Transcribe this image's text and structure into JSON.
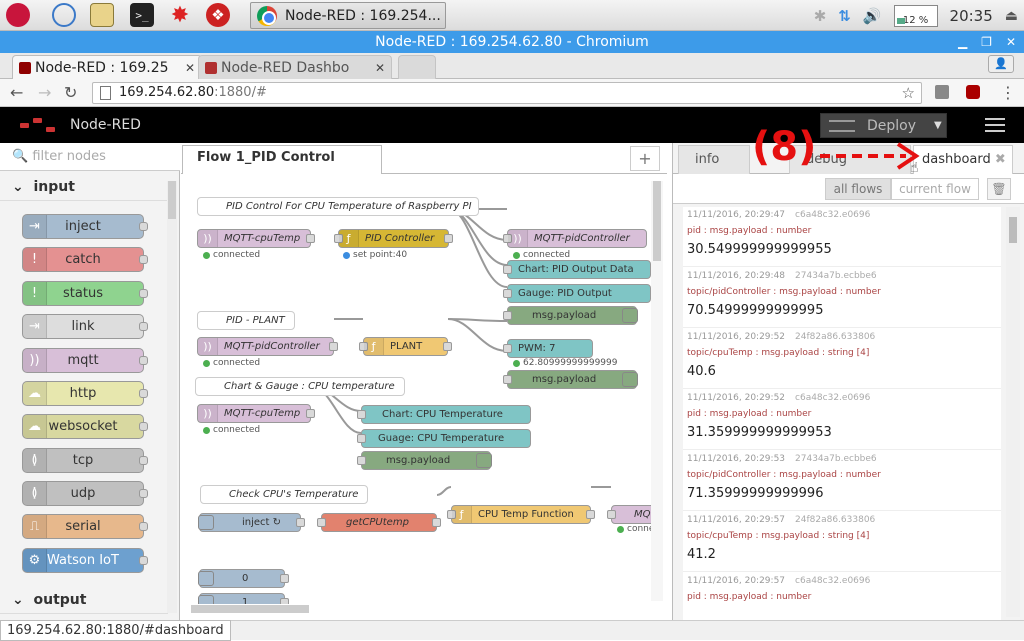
{
  "taskbar": {
    "task_title": "Node-RED : 169.254...",
    "cpu": "12 %",
    "clock": "20:35"
  },
  "window": {
    "title": "Node-RED : 169.254.62.80 - Chromium"
  },
  "browser": {
    "tabs": [
      {
        "label": "Node-RED : 169.25"
      },
      {
        "label": "Node-RED Dashbo"
      }
    ],
    "url_host": "169.254.62.80",
    "url_rest": ":1880/#"
  },
  "nodered": {
    "app_title": "Node-RED",
    "deploy_label": "Deploy"
  },
  "palette": {
    "filter_placeholder": "filter nodes",
    "categories": [
      {
        "label": "input"
      },
      {
        "label": "output"
      }
    ],
    "nodes": [
      {
        "label": "inject",
        "color": "#a6bbcf"
      },
      {
        "label": "catch",
        "color": "#e49191"
      },
      {
        "label": "status",
        "color": "#94c1d0"
      },
      {
        "label": "link",
        "color": "#dddddd"
      },
      {
        "label": "mqtt",
        "color": "#d8bfd8"
      },
      {
        "label": "http",
        "color": "#e7e7ae"
      },
      {
        "label": "websocket",
        "color": "#d8d8a0"
      },
      {
        "label": "tcp",
        "color": "#c0c0c0"
      },
      {
        "label": "udp",
        "color": "#c0c0c0"
      },
      {
        "label": "serial",
        "color": "#e7b88c"
      },
      {
        "label": "Watson IoT",
        "color": "#6da0cf"
      }
    ]
  },
  "workspace": {
    "flow_tab": "Flow 1_PID Control",
    "comments": [
      {
        "label": "PID Control For CPU Temperature of Raspberry PI"
      },
      {
        "label": "PID - PLANT"
      },
      {
        "label": "Chart & Gauge : CPU temperature"
      },
      {
        "label": "Check CPU's Temperature"
      }
    ],
    "nodes": [
      {
        "label": "MQTT-cpuTemp"
      },
      {
        "label": "PID Controller"
      },
      {
        "label": "MQTT-pidController"
      },
      {
        "label": "Chart: PID Output Data"
      },
      {
        "label": "Gauge: PID Output"
      },
      {
        "label": "msg.payload"
      },
      {
        "label": "MQTT-pidController"
      },
      {
        "label": "PLANT"
      },
      {
        "label": "PWM: 7"
      },
      {
        "label": "msg.payload"
      },
      {
        "label": "MQTT-cpuTemp"
      },
      {
        "label": "Chart: CPU Temperature"
      },
      {
        "label": "Guage: CPU Temperature"
      },
      {
        "label": "msg.payload"
      },
      {
        "label": "inject ↻"
      },
      {
        "label": "getCPUtemp"
      },
      {
        "label": "CPU Temp Function"
      },
      {
        "label": "MQ"
      },
      {
        "label": "0"
      },
      {
        "label": "1"
      }
    ],
    "status": {
      "connected": "connected",
      "setpoint": "set point:40",
      "pwm_value": "62.80999999999999",
      "conn_short": "conne"
    }
  },
  "sidebar": {
    "tabs": [
      {
        "label": "info"
      },
      {
        "label": "debug"
      },
      {
        "label": "dashboard"
      }
    ],
    "filter_all": "all flows",
    "filter_current": "current flow",
    "messages": [
      {
        "time": "11/11/2016, 20:29:47",
        "node": "c6a48c32.e0696",
        "topic": "pid : msg.payload : number",
        "value": "30.549999999999955"
      },
      {
        "time": "11/11/2016, 20:29:48",
        "node": "27434a7b.ecbbe6",
        "topic": "topic/pidController : msg.payload : number",
        "value": "70.54999999999995"
      },
      {
        "time": "11/11/2016, 20:29:52",
        "node": "24f82a86.633806",
        "topic": "topic/cpuTemp : msg.payload : string [4]",
        "value": "40.6"
      },
      {
        "time": "11/11/2016, 20:29:52",
        "node": "c6a48c32.e0696",
        "topic": "pid : msg.payload : number",
        "value": "31.359999999999953"
      },
      {
        "time": "11/11/2016, 20:29:53",
        "node": "27434a7b.ecbbe6",
        "topic": "topic/pidController : msg.payload : number",
        "value": "71.35999999999996"
      },
      {
        "time": "11/11/2016, 20:29:57",
        "node": "24f82a86.633806",
        "topic": "topic/cpuTemp : msg.payload : string [4]",
        "value": "41.2"
      },
      {
        "time": "11/11/2016, 20:29:57",
        "node": "c6a48c32.e0696",
        "topic": "pid : msg.payload : number",
        "value": ""
      }
    ]
  },
  "annotation": "(8)",
  "statusbar": {
    "url": "169.254.62.80:1880/#dashboard"
  }
}
